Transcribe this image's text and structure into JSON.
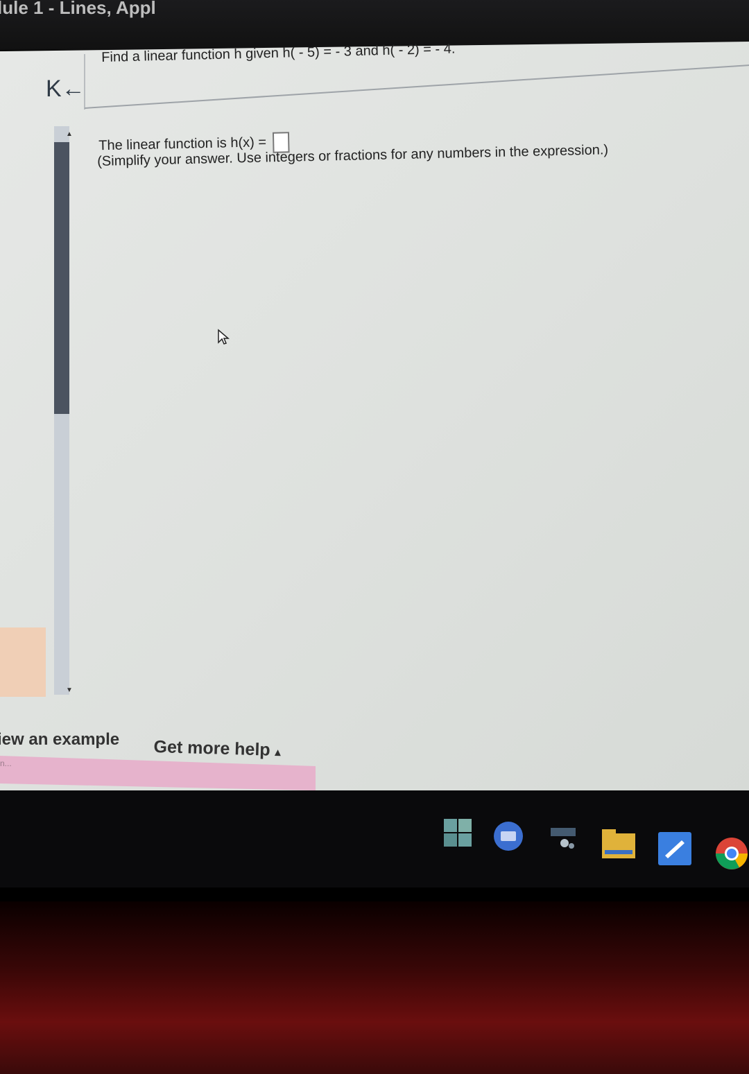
{
  "window": {
    "title": "lule 1 - Lines, Appl"
  },
  "nav": {
    "back_icon": "first-page-icon",
    "back_glyph": "K←"
  },
  "question": {
    "text": "Find a linear function h given h( - 5) = - 3 and h( - 2) = - 4."
  },
  "answer": {
    "prompt": "The linear function is h(x) =",
    "value": "",
    "instructions": "(Simplify your answer. Use integers or fractions for any numbers in the expression.)"
  },
  "footer": {
    "view_example": "iew an example",
    "get_more_help": "Get more help",
    "get_more_help_arrow": "▴",
    "pink_text": "n..."
  },
  "taskbar": {
    "icons": [
      "windows-grid-icon",
      "meet-icon",
      "app-icon",
      "files-icon",
      "docs-icon",
      "chrome-icon"
    ]
  },
  "colors": {
    "screen_bg": "#e2e5e2",
    "scroll_thumb": "#4b5360",
    "pink_bar": "#e6b3cc",
    "chrome_red": "#db4437",
    "chrome_yellow": "#f4b400",
    "chrome_green": "#0f9d58",
    "chrome_blue": "#4285f4"
  }
}
